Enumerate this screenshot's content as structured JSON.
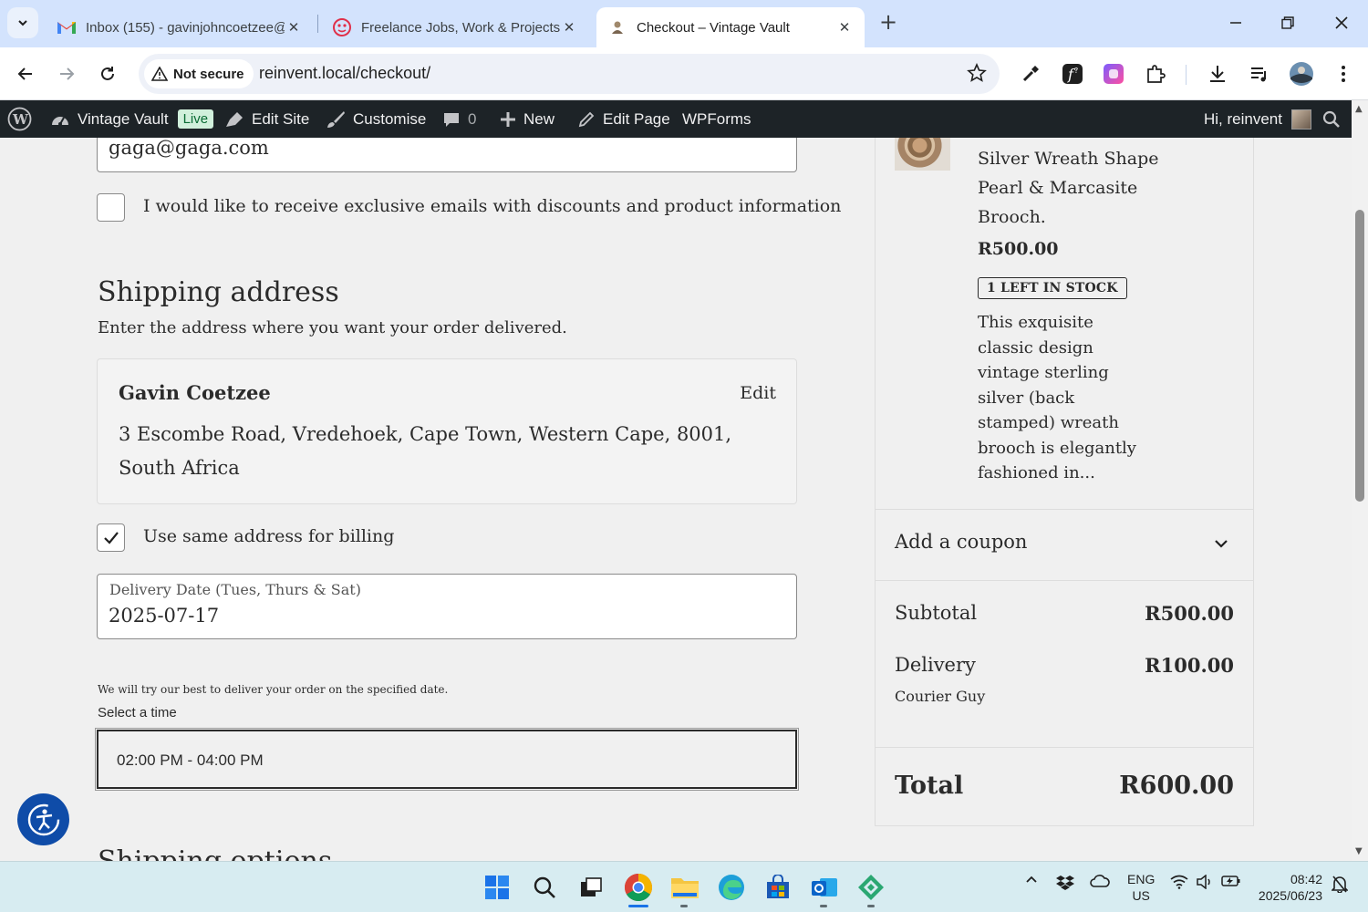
{
  "browser": {
    "tabs": [
      {
        "title": "Inbox (155) - gavinjohncoetzee@",
        "icon": "gmail-icon",
        "active": false
      },
      {
        "title": "Freelance Jobs, Work & Projects",
        "icon": "freelancer-icon",
        "active": false
      },
      {
        "title": "Checkout – Vintage Vault",
        "icon": "vintage-vault-icon",
        "active": true
      }
    ],
    "security_label": "Not secure",
    "url": "reinvent.local/checkout/"
  },
  "adminbar": {
    "site_name": "Vintage Vault",
    "live_badge": "Live",
    "edit_site": "Edit Site",
    "customise": "Customise",
    "comments_count": "0",
    "new": "New",
    "edit_page": "Edit Page",
    "wpforms": "WPForms",
    "greeting": "Hi, reinvent"
  },
  "checkout": {
    "email_value": "gaga@gaga.com",
    "marketing_optin_label": "I would like to receive exclusive emails with discounts and product information",
    "marketing_optin_checked": false,
    "shipping_heading": "Shipping address",
    "shipping_description": "Enter the address where you want your order delivered.",
    "address": {
      "name": "Gavin Coetzee",
      "edit_label": "Edit",
      "line": "3 Escombe Road, Vredehoek, Cape Town, Western Cape, 8001, South Africa"
    },
    "same_billing_label": "Use same address for billing",
    "same_billing_checked": true,
    "delivery_date_label": "Delivery Date (Tues, Thurs & Sat)",
    "delivery_date_value": "2025-07-17",
    "delivery_note": "We will try our best to deliver your order on the specified date.",
    "time_label": "Select a time",
    "time_value": "02:00 PM - 04:00 PM",
    "next_section_heading": "Shipping options"
  },
  "summary": {
    "product_name": "Silver Wreath Shape Pearl & Marcasite Brooch.",
    "product_price": "R500.00",
    "stock_badge": "1 LEFT IN STOCK",
    "product_description": "This exquisite classic design vintage sterling silver (back stamped) wreath brooch is elegantly fashioned in...",
    "coupon_label": "Add a coupon",
    "subtotal_label": "Subtotal",
    "subtotal_value": "R500.00",
    "delivery_label": "Delivery",
    "delivery_value": "R100.00",
    "delivery_method": "Courier Guy",
    "total_label": "Total",
    "total_value": "R600.00"
  },
  "taskbar": {
    "lang_line1": "ENG",
    "lang_line2": "US",
    "time": "08:42",
    "date": "2025/06/23"
  },
  "colors": {
    "tabstrip": "#d3e3fd",
    "adminbar": "#1d2327",
    "accessibility_button": "#0f4ca8",
    "live_badge_bg": "#d1f0dc"
  }
}
